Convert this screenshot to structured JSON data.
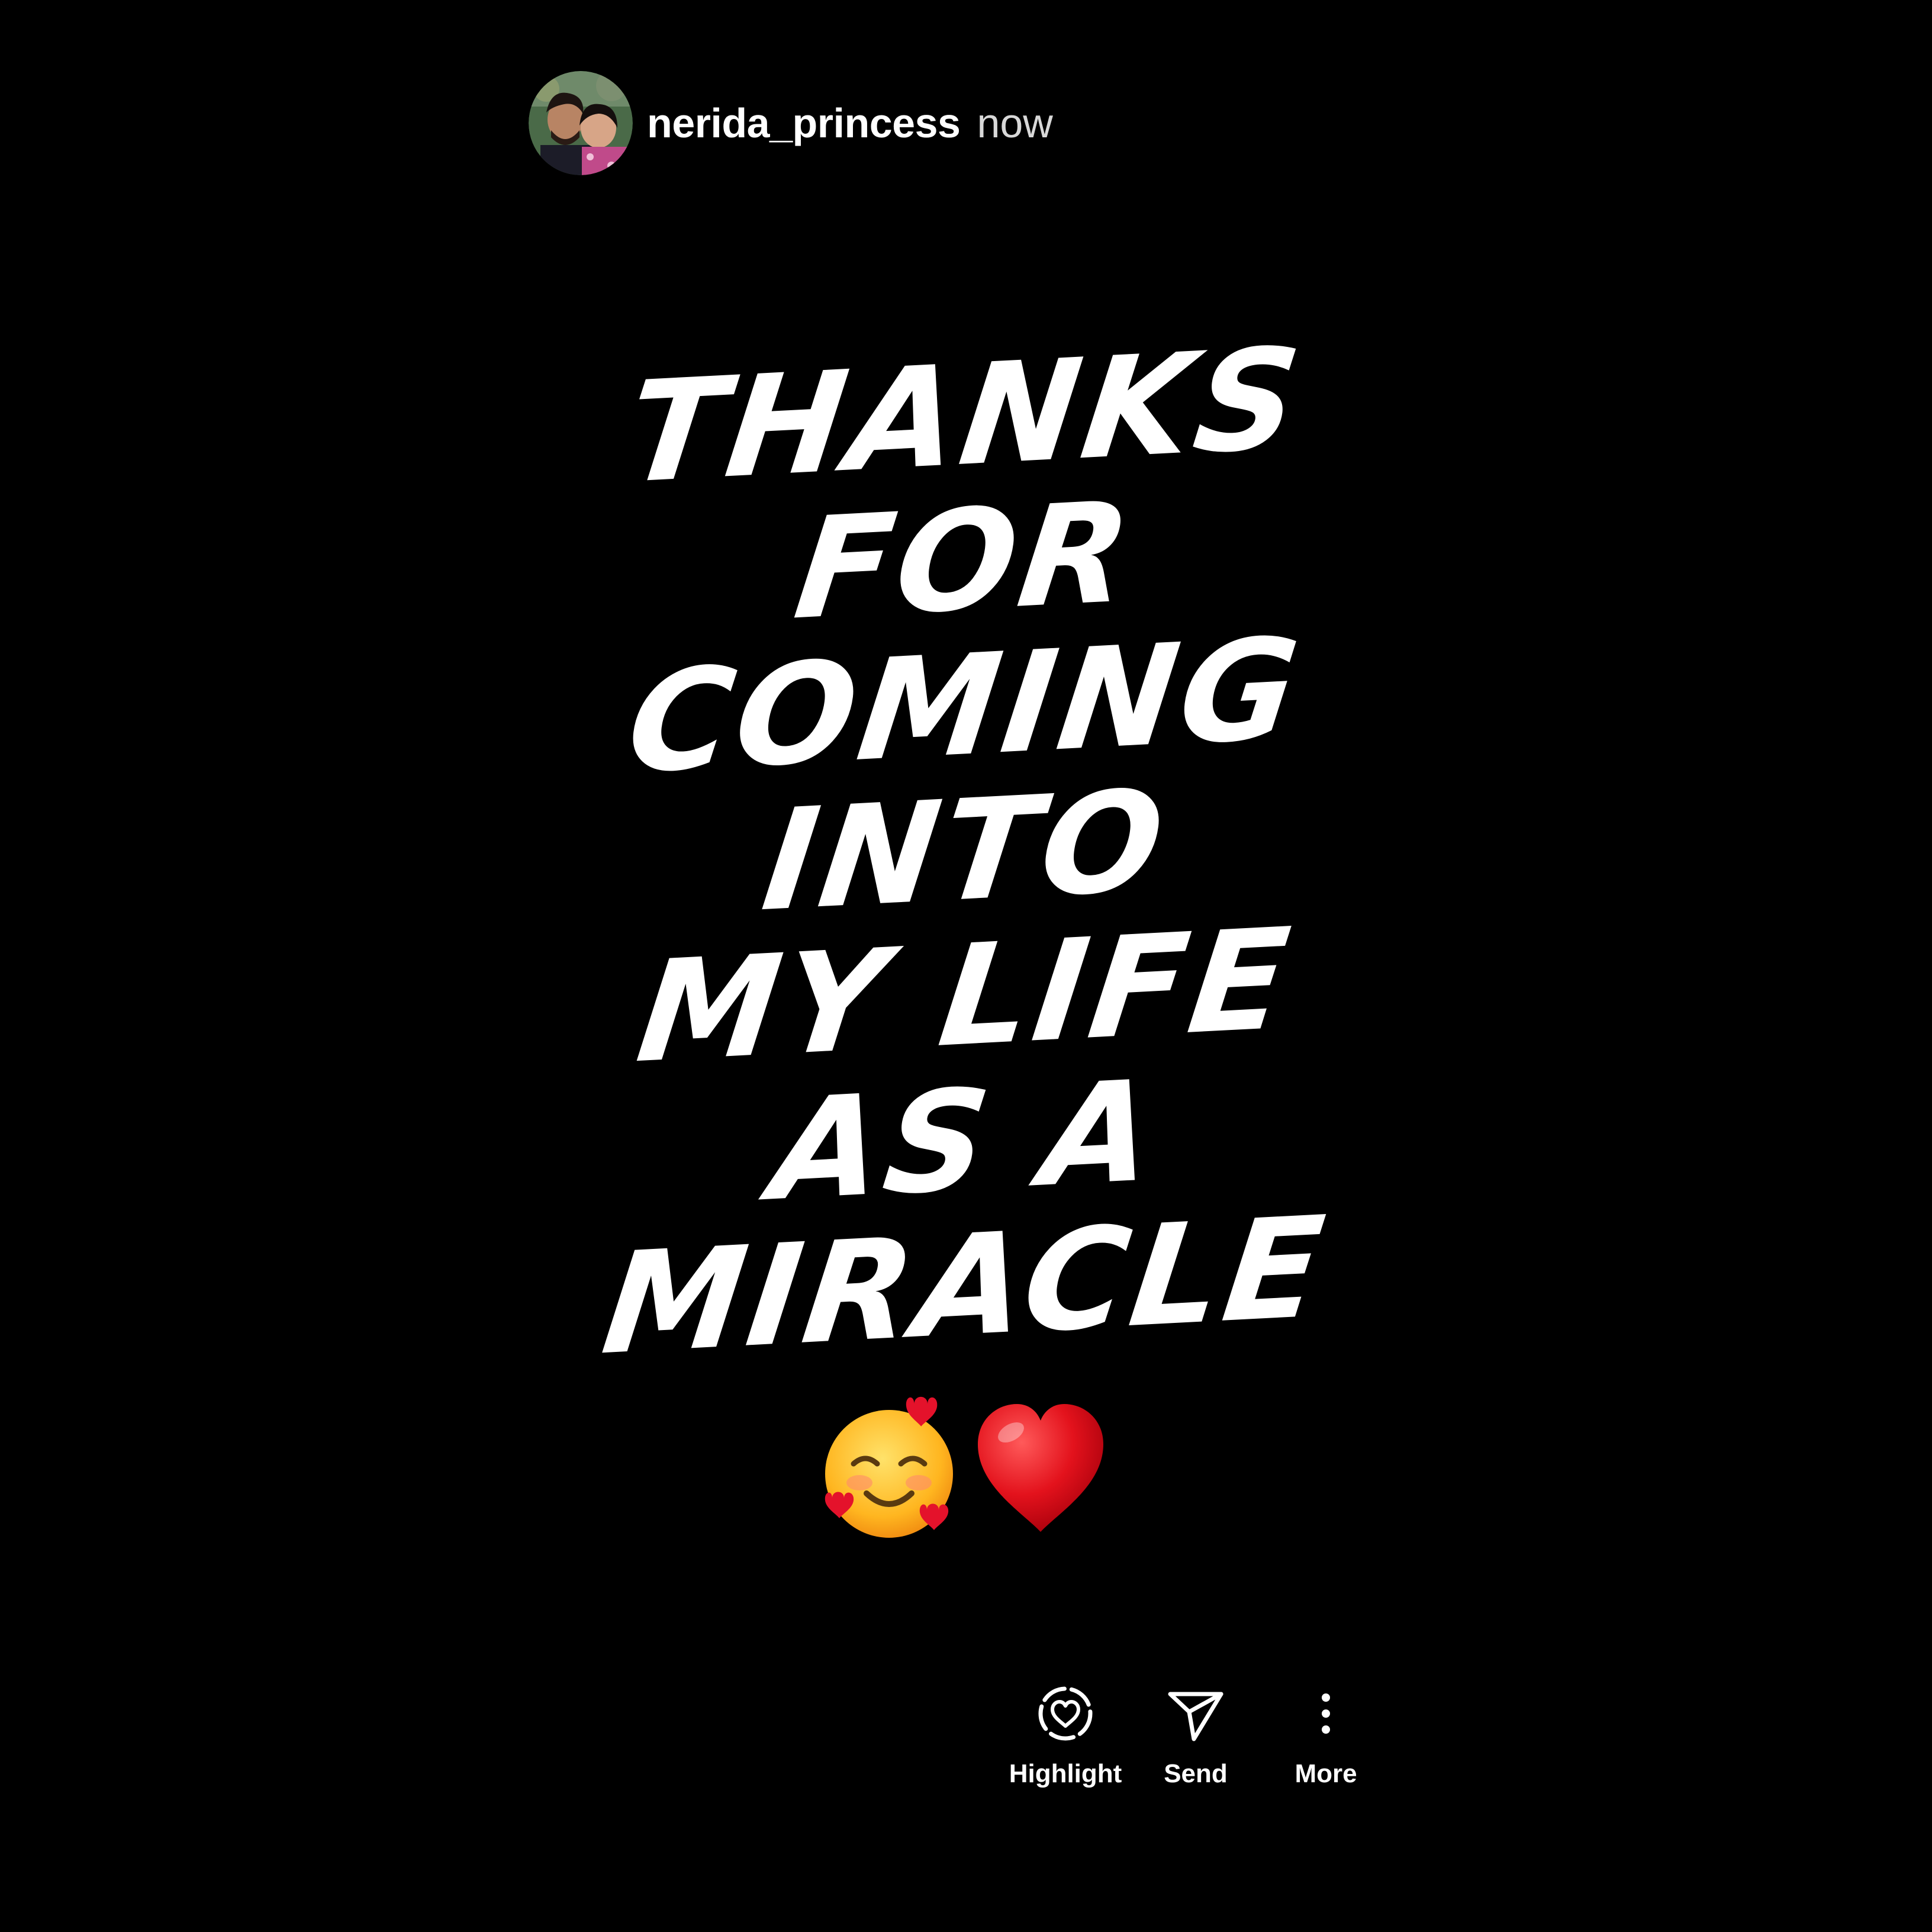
{
  "header": {
    "username": "nerida_princess",
    "timestamp": "now"
  },
  "story": {
    "lines": [
      "THANKS",
      "FOR",
      "COMING",
      "INTO",
      "MY LIFE",
      "AS A",
      "MIRACLE"
    ],
    "emojis": [
      "smiling-face-with-hearts",
      "red-heart"
    ]
  },
  "actions": {
    "highlight_label": "Highlight",
    "send_label": "Send",
    "more_label": "More"
  },
  "colors": {
    "background": "#000000",
    "text": "#ffffff",
    "timestamp": "#d8d8d8"
  }
}
